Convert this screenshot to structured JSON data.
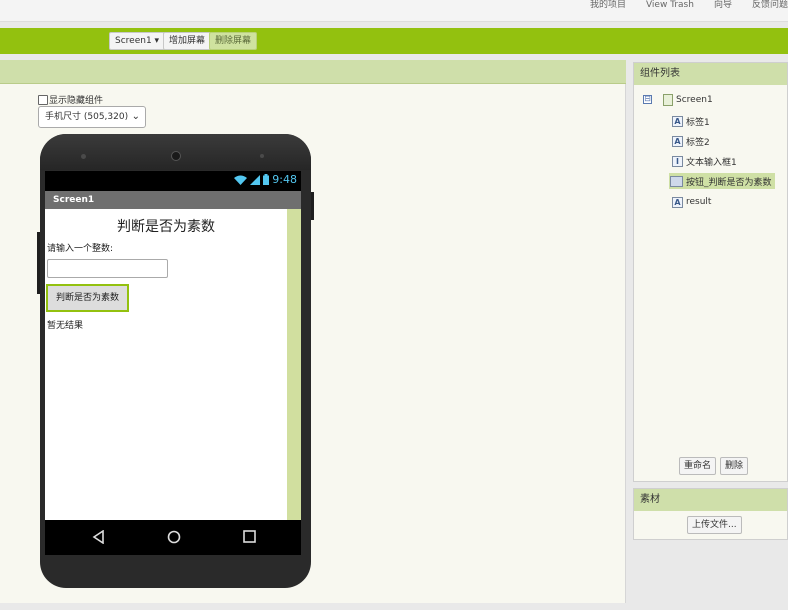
{
  "top_menu": {
    "links": [
      "我的项目",
      "View Trash",
      "向导",
      "反馈问题"
    ]
  },
  "toolbar": {
    "screen_select": "Screen1 ▾",
    "add_screen": "增加屏幕",
    "remove_screen": "删除屏幕"
  },
  "viewer": {
    "show_hidden_label": "显示隐藏组件",
    "size_select_value": "手机尺寸 (505,320)"
  },
  "phone": {
    "status_time": "9:48",
    "title_bar": "Screen1",
    "app_title": "判断是否为素数",
    "label1_text": "请输入一个整数:",
    "textbox_value": "",
    "button_text": "判断是否为素数",
    "result_text": "暂无结果"
  },
  "components": {
    "header": "组件列表",
    "toggle": "⊟",
    "items": [
      {
        "label": "Screen1",
        "icon": "screen-icon"
      },
      {
        "label": "标签1",
        "icon": "label-icon"
      },
      {
        "label": "标签2",
        "icon": "label-icon"
      },
      {
        "label": "文本输入框1",
        "icon": "textbox-icon"
      },
      {
        "label": "按钮_判断是否为素数",
        "icon": "button-icon"
      },
      {
        "label": "result",
        "icon": "label-icon"
      }
    ],
    "rename_button": "重命名",
    "delete_button": "删除"
  },
  "media": {
    "header": "素材",
    "upload_button": "上传文件..."
  },
  "colors": {
    "toolbar_green": "#93c10f",
    "panel_header": "#cfdfaa",
    "selected_item": "#cfe0a5",
    "status_icon_blue": "#53c7f0"
  }
}
